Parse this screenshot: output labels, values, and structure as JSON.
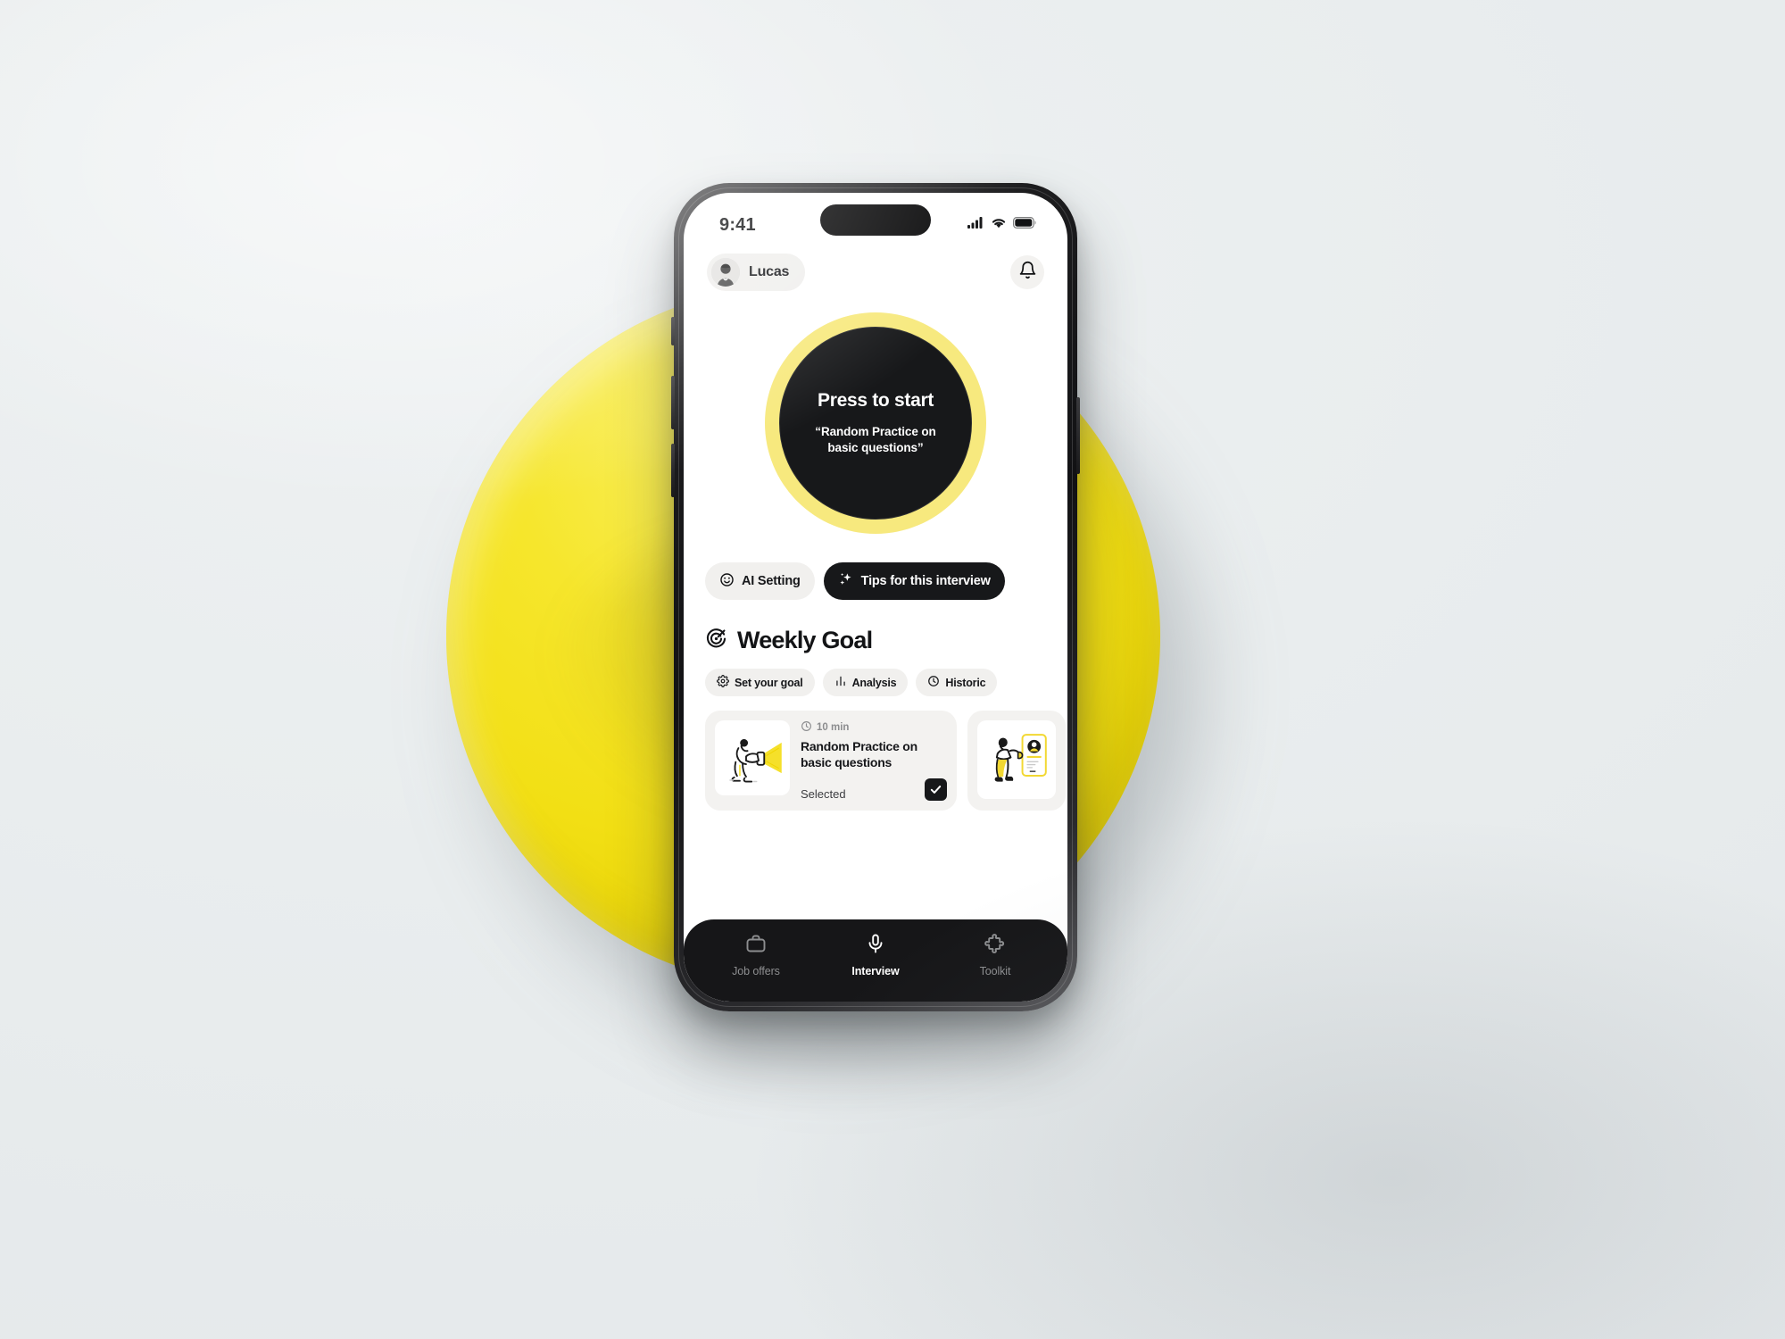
{
  "scene": {
    "background_color": "#e9edee",
    "disc_color": "#f2df14",
    "accent_yellow": "#f7e97e",
    "dark": "#17181a"
  },
  "status_bar": {
    "time": "9:41",
    "icons": [
      "cellular-signal-icon",
      "wifi-icon",
      "battery-icon"
    ]
  },
  "topbar": {
    "user_name": "Lucas",
    "avatar_name": "user-avatar",
    "notification_icon": "bell-icon"
  },
  "start_button": {
    "title": "Press to start",
    "subtitle": "“Random Practice on basic questions”"
  },
  "actions": [
    {
      "label": "AI Setting",
      "icon": "smiley-icon",
      "style": "light"
    },
    {
      "label": "Tips for this interview",
      "icon": "sparkle-icon",
      "style": "dark"
    }
  ],
  "weekly_goal": {
    "title": "Weekly Goal",
    "icon": "target-icon",
    "filters": [
      {
        "label": "Set your goal",
        "icon": "gear-icon"
      },
      {
        "label": "Analysis",
        "icon": "bar-chart-icon"
      },
      {
        "label": "Historic",
        "icon": "clock-icon"
      }
    ],
    "cards": [
      {
        "duration": "10 min",
        "duration_icon": "clock-icon",
        "title": "Random Practice on basic questions",
        "status": "Selected",
        "checked": true,
        "thumb": "flashlight-person-illustration"
      },
      {
        "thumb": "resume-review-person-illustration"
      }
    ]
  },
  "bottom_nav": {
    "items": [
      {
        "label": "Job offers",
        "icon": "briefcase-icon",
        "active": false
      },
      {
        "label": "Interview",
        "icon": "microphone-icon",
        "active": true
      },
      {
        "label": "Toolkit",
        "icon": "puzzle-piece-icon",
        "active": false
      }
    ]
  }
}
